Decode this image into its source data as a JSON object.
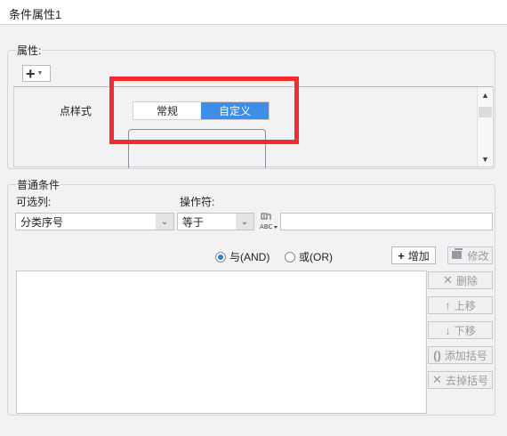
{
  "window": {
    "title": "条件属性1"
  },
  "attributes": {
    "group_label": "属性:",
    "add_glyph": "+",
    "row_label": "点样式",
    "style_options": [
      "常规",
      "自定义"
    ],
    "selected_style": "自定义"
  },
  "conditions": {
    "group_label": "普通条件",
    "column_label": "可选列:",
    "column_value": "分类序号",
    "operator_label": "操作符:",
    "operator_value": "等于",
    "value_input": "",
    "logic": [
      {
        "label": "与(AND)",
        "checked": true
      },
      {
        "label": "或(OR)",
        "checked": false
      }
    ],
    "add_button": "增加",
    "modify_button": "修改",
    "side_buttons": [
      "删除",
      "上移",
      "下移",
      "添加括号",
      "去掉括号"
    ]
  },
  "colors": {
    "accent": "#3c8ee9",
    "highlight": "#f32b2e"
  }
}
